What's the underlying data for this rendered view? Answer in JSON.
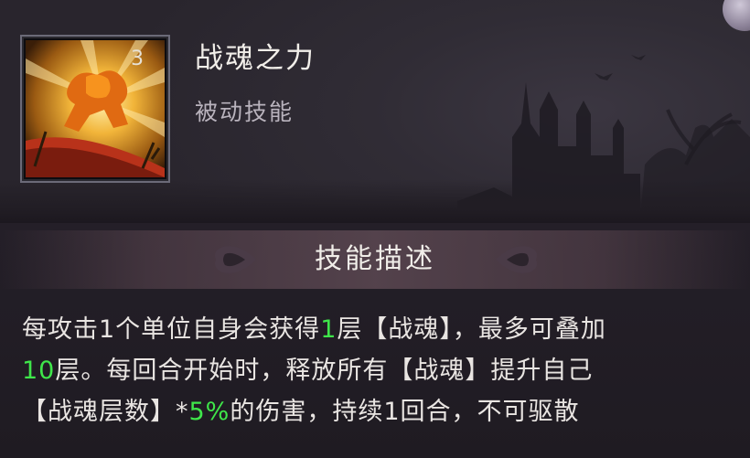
{
  "skill": {
    "name": "战魂之力",
    "type": "被动技能",
    "level": "3"
  },
  "section": {
    "title": "技能描述"
  },
  "description": {
    "line1": {
      "a": "每攻击1个单位自身会获得",
      "b": "1",
      "c": "层【战魂】，最多可叠加"
    },
    "line2": {
      "a": "10",
      "b": "层。每回合开始时，释放所有【战魂】提升自己"
    },
    "line3": {
      "a": "【战魂层数】*",
      "b": "5%",
      "c": "的伤害，持续1回合，不可驱散"
    }
  },
  "colors": {
    "highlight": "#3fe64a",
    "text": "#e9e5e2",
    "background": "#2a2630"
  },
  "icons": [
    "skill-fighting-spirit-icon",
    "castle-silhouette",
    "ornament-left",
    "ornament-right"
  ]
}
